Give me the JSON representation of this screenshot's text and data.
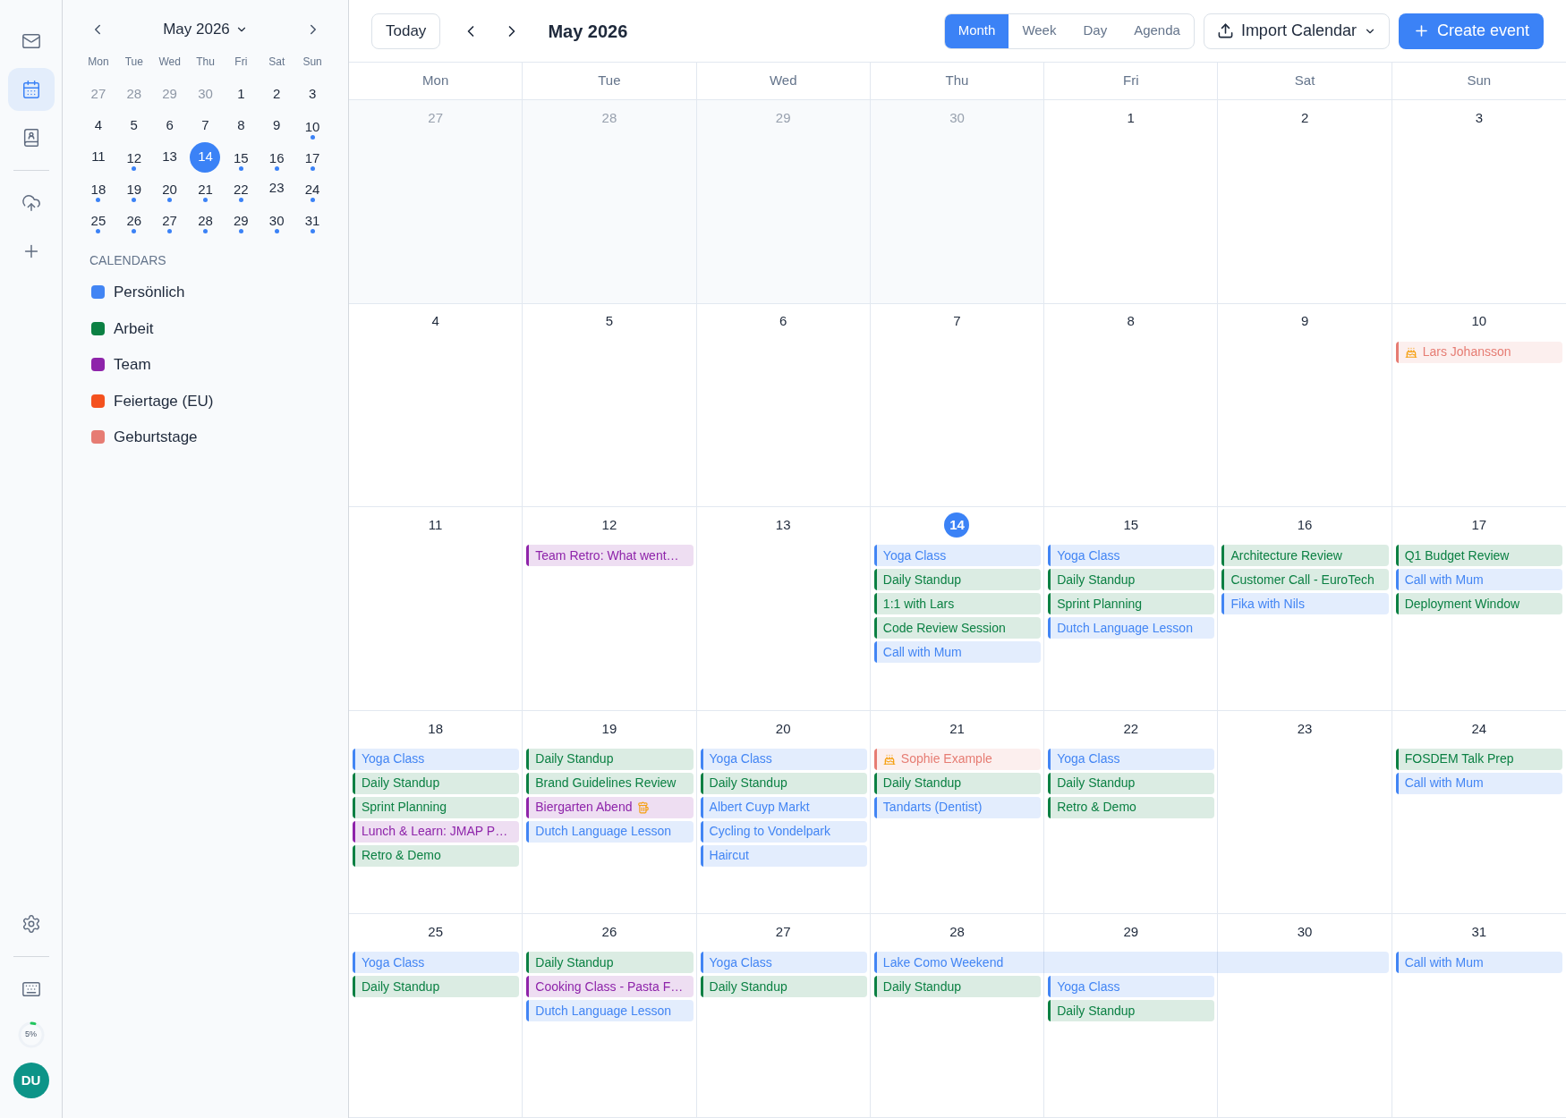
{
  "rail": {
    "top": [
      {
        "kind": "mail",
        "selected": false
      },
      {
        "kind": "calendar",
        "selected": true
      },
      {
        "kind": "contacts",
        "selected": false
      }
    ],
    "middle": [
      {
        "kind": "upload"
      },
      {
        "kind": "add"
      }
    ],
    "bottom": [
      {
        "kind": "settings"
      },
      {
        "kind": "keyboard"
      }
    ],
    "storage": {
      "level": 0.05,
      "label": "5%"
    },
    "avatar": "DU"
  },
  "mini_calendar": {
    "title": "May 2026",
    "weekdays": [
      "Mon",
      "Tue",
      "Wed",
      "Thu",
      "Fri",
      "Sat",
      "Sun"
    ],
    "days": [
      {
        "label": "27",
        "muted": true,
        "selected": false,
        "has_events": false
      },
      {
        "label": "28",
        "muted": true,
        "selected": false,
        "has_events": false
      },
      {
        "label": "29",
        "muted": true,
        "selected": false,
        "has_events": false
      },
      {
        "label": "30",
        "muted": true,
        "selected": false,
        "has_events": false
      },
      {
        "label": "1",
        "muted": false,
        "selected": false,
        "has_events": false
      },
      {
        "label": "2",
        "muted": false,
        "selected": false,
        "has_events": false
      },
      {
        "label": "3",
        "muted": false,
        "selected": false,
        "has_events": false
      },
      {
        "label": "4",
        "muted": false,
        "selected": false,
        "has_events": false
      },
      {
        "label": "5",
        "muted": false,
        "selected": false,
        "has_events": false
      },
      {
        "label": "6",
        "muted": false,
        "selected": false,
        "has_events": false
      },
      {
        "label": "7",
        "muted": false,
        "selected": false,
        "has_events": false
      },
      {
        "label": "8",
        "muted": false,
        "selected": false,
        "has_events": false
      },
      {
        "label": "9",
        "muted": false,
        "selected": false,
        "has_events": false
      },
      {
        "label": "10",
        "muted": false,
        "selected": false,
        "has_events": true
      },
      {
        "label": "11",
        "muted": false,
        "selected": false,
        "has_events": false
      },
      {
        "label": "12",
        "muted": false,
        "selected": false,
        "has_events": true
      },
      {
        "label": "13",
        "muted": false,
        "selected": false,
        "has_events": false
      },
      {
        "label": "14",
        "muted": false,
        "selected": true,
        "has_events": false
      },
      {
        "label": "15",
        "muted": false,
        "selected": false,
        "has_events": true
      },
      {
        "label": "16",
        "muted": false,
        "selected": false,
        "has_events": true
      },
      {
        "label": "17",
        "muted": false,
        "selected": false,
        "has_events": true
      },
      {
        "label": "18",
        "muted": false,
        "selected": false,
        "has_events": true
      },
      {
        "label": "19",
        "muted": false,
        "selected": false,
        "has_events": true
      },
      {
        "label": "20",
        "muted": false,
        "selected": false,
        "has_events": true
      },
      {
        "label": "21",
        "muted": false,
        "selected": false,
        "has_events": true
      },
      {
        "label": "22",
        "muted": false,
        "selected": false,
        "has_events": true
      },
      {
        "label": "23",
        "muted": false,
        "selected": false,
        "has_events": false
      },
      {
        "label": "24",
        "muted": false,
        "selected": false,
        "has_events": true
      },
      {
        "label": "25",
        "muted": false,
        "selected": false,
        "has_events": true
      },
      {
        "label": "26",
        "muted": false,
        "selected": false,
        "has_events": true
      },
      {
        "label": "27",
        "muted": false,
        "selected": false,
        "has_events": true
      },
      {
        "label": "28",
        "muted": false,
        "selected": false,
        "has_events": true
      },
      {
        "label": "29",
        "muted": false,
        "selected": false,
        "has_events": true
      },
      {
        "label": "30",
        "muted": false,
        "selected": false,
        "has_events": true
      },
      {
        "label": "31",
        "muted": false,
        "selected": false,
        "has_events": true
      }
    ]
  },
  "calendars": {
    "heading": "CALENDARS",
    "items": [
      {
        "name": "Persönlich",
        "color": "#4285f4"
      },
      {
        "name": "Arbeit",
        "color": "#0b8043"
      },
      {
        "name": "Team",
        "color": "#8e24aa"
      },
      {
        "name": "Feiertage (EU)",
        "color": "#f4511e"
      },
      {
        "name": "Geburtstage",
        "color": "#e67c73"
      }
    ]
  },
  "toolbar": {
    "today": "Today",
    "title": "May 2026",
    "views": [
      {
        "label": "Month",
        "selected": true
      },
      {
        "label": "Week",
        "selected": false
      },
      {
        "label": "Day",
        "selected": false
      },
      {
        "label": "Agenda",
        "selected": false
      }
    ],
    "import": "Import Calendar",
    "create": "Create event"
  },
  "month": {
    "weekdays": [
      "Mon",
      "Tue",
      "Wed",
      "Thu",
      "Fri",
      "Sat",
      "Sun"
    ],
    "weeks": [
      {
        "days": [
          {
            "date": "27",
            "muted": true,
            "today": false
          },
          {
            "date": "28",
            "muted": true,
            "today": false
          },
          {
            "date": "29",
            "muted": true,
            "today": false
          },
          {
            "date": "30",
            "muted": true,
            "today": false
          },
          {
            "date": "1",
            "muted": false,
            "today": false
          },
          {
            "date": "2",
            "muted": false,
            "today": false
          },
          {
            "date": "3",
            "muted": false,
            "today": false
          }
        ]
      },
      {
        "days": [
          {
            "date": "4",
            "muted": false,
            "today": false
          },
          {
            "date": "5",
            "muted": false,
            "today": false
          },
          {
            "date": "6",
            "muted": false,
            "today": false
          },
          {
            "date": "7",
            "muted": false,
            "today": false
          },
          {
            "date": "8",
            "muted": false,
            "today": false
          },
          {
            "date": "9",
            "muted": false,
            "today": false
          },
          {
            "date": "10",
            "muted": false,
            "today": false,
            "events": [
              {
                "kind": "birthday",
                "title": "Lars Johansson",
                "color": "#e67c73"
              }
            ]
          }
        ]
      },
      {
        "days": [
          {
            "date": "11",
            "muted": false,
            "today": false
          },
          {
            "date": "12",
            "muted": false,
            "today": false,
            "events": [
              {
                "kind": "event",
                "title": "Team Retro: What went…",
                "color": "#8e24aa"
              }
            ]
          },
          {
            "date": "13",
            "muted": false,
            "today": false
          },
          {
            "date": "14",
            "muted": false,
            "today": true,
            "events": [
              {
                "kind": "event",
                "title": "Yoga Class",
                "color": "#4285f4"
              },
              {
                "kind": "event",
                "title": "Daily Standup",
                "color": "#0b8043"
              },
              {
                "kind": "event",
                "title": "1:1 with Lars",
                "color": "#0b8043"
              },
              {
                "kind": "event",
                "title": "Code Review Session",
                "color": "#0b8043"
              },
              {
                "kind": "event",
                "title": "Call with Mum",
                "color": "#4285f4"
              }
            ]
          },
          {
            "date": "15",
            "muted": false,
            "today": false,
            "events": [
              {
                "kind": "event",
                "title": "Yoga Class",
                "color": "#4285f4"
              },
              {
                "kind": "event",
                "title": "Daily Standup",
                "color": "#0b8043"
              },
              {
                "kind": "event",
                "title": "Sprint Planning",
                "color": "#0b8043"
              },
              {
                "kind": "event",
                "title": "Dutch Language Lesson",
                "color": "#4285f4"
              }
            ]
          },
          {
            "date": "16",
            "muted": false,
            "today": false,
            "events": [
              {
                "kind": "event",
                "title": "Architecture Review",
                "color": "#0b8043"
              },
              {
                "kind": "event",
                "title": "Customer Call - EuroTech",
                "color": "#0b8043"
              },
              {
                "kind": "event",
                "title": "Fika with Nils",
                "color": "#4285f4"
              }
            ]
          },
          {
            "date": "17",
            "muted": false,
            "today": false,
            "events": [
              {
                "kind": "event",
                "title": "Q1 Budget Review",
                "color": "#0b8043"
              },
              {
                "kind": "event",
                "title": "Call with Mum",
                "color": "#4285f4"
              },
              {
                "kind": "event",
                "title": "Deployment Window",
                "color": "#0b8043"
              }
            ]
          }
        ]
      },
      {
        "days": [
          {
            "date": "18",
            "muted": false,
            "today": false,
            "events": [
              {
                "kind": "event",
                "title": "Yoga Class",
                "color": "#4285f4"
              },
              {
                "kind": "event",
                "title": "Daily Standup",
                "color": "#0b8043"
              },
              {
                "kind": "event",
                "title": "Sprint Planning",
                "color": "#0b8043"
              },
              {
                "kind": "event",
                "title": "Lunch & Learn: JMAP P…",
                "color": "#8e24aa"
              },
              {
                "kind": "event",
                "title": "Retro & Demo",
                "color": "#0b8043"
              }
            ]
          },
          {
            "date": "19",
            "muted": false,
            "today": false,
            "events": [
              {
                "kind": "event",
                "title": "Daily Standup",
                "color": "#0b8043"
              },
              {
                "kind": "event",
                "title": "Brand Guidelines Review",
                "color": "#0b8043"
              },
              {
                "kind": "drinks",
                "title": "Biergarten Abend",
                "color": "#8e24aa"
              },
              {
                "kind": "event",
                "title": "Dutch Language Lesson",
                "color": "#4285f4"
              }
            ]
          },
          {
            "date": "20",
            "muted": false,
            "today": false,
            "events": [
              {
                "kind": "event",
                "title": "Yoga Class",
                "color": "#4285f4"
              },
              {
                "kind": "event",
                "title": "Daily Standup",
                "color": "#0b8043"
              },
              {
                "kind": "event",
                "title": "Albert Cuyp Markt",
                "color": "#4285f4"
              },
              {
                "kind": "event",
                "title": "Cycling to Vondelpark",
                "color": "#4285f4"
              },
              {
                "kind": "event",
                "title": "Haircut",
                "color": "#4285f4"
              }
            ]
          },
          {
            "date": "21",
            "muted": false,
            "today": false,
            "events": [
              {
                "kind": "birthday",
                "title": "Sophie Example",
                "color": "#e67c73"
              },
              {
                "kind": "event",
                "title": "Daily Standup",
                "color": "#0b8043"
              },
              {
                "kind": "event",
                "title": "Tandarts (Dentist)",
                "color": "#4285f4"
              }
            ]
          },
          {
            "date": "22",
            "muted": false,
            "today": false,
            "events": [
              {
                "kind": "event",
                "title": "Yoga Class",
                "color": "#4285f4"
              },
              {
                "kind": "event",
                "title": "Daily Standup",
                "color": "#0b8043"
              },
              {
                "kind": "event",
                "title": "Retro & Demo",
                "color": "#0b8043"
              }
            ]
          },
          {
            "date": "23",
            "muted": false,
            "today": false
          },
          {
            "date": "24",
            "muted": false,
            "today": false,
            "events": [
              {
                "kind": "event",
                "title": "FOSDEM Talk Prep",
                "color": "#0b8043"
              },
              {
                "kind": "event",
                "title": "Call with Mum",
                "color": "#4285f4"
              }
            ]
          }
        ]
      },
      {
        "days": [
          {
            "date": "25",
            "muted": false,
            "today": false,
            "events": [
              {
                "kind": "event",
                "title": "Yoga Class",
                "color": "#4285f4"
              },
              {
                "kind": "event",
                "title": "Daily Standup",
                "color": "#0b8043"
              }
            ]
          },
          {
            "date": "26",
            "muted": false,
            "today": false,
            "events": [
              {
                "kind": "event",
                "title": "Daily Standup",
                "color": "#0b8043"
              },
              {
                "kind": "event",
                "title": "Cooking Class - Pasta F…",
                "color": "#8e24aa"
              },
              {
                "kind": "event",
                "title": "Dutch Language Lesson",
                "color": "#4285f4"
              }
            ]
          },
          {
            "date": "27",
            "muted": false,
            "today": false,
            "events": [
              {
                "kind": "event",
                "title": "Yoga Class",
                "color": "#4285f4"
              },
              {
                "kind": "event",
                "title": "Daily Standup",
                "color": "#0b8043"
              }
            ]
          },
          {
            "date": "28",
            "muted": false,
            "today": false,
            "events": [
              {
                "kind": "multi_day",
                "title": "Lake Como Weekend",
                "color": "#4285f4"
              },
              {
                "kind": "event",
                "title": "Daily Standup",
                "color": "#0b8043"
              }
            ]
          },
          {
            "date": "29",
            "muted": false,
            "today": false,
            "events": [
              {
                "kind": "continuation"
              },
              {
                "kind": "event",
                "title": "Yoga Class",
                "color": "#4285f4"
              },
              {
                "kind": "event",
                "title": "Daily Standup",
                "color": "#0b8043"
              }
            ]
          },
          {
            "date": "30",
            "muted": false,
            "today": false,
            "events": [
              {
                "kind": "continuation"
              }
            ]
          },
          {
            "date": "31",
            "muted": false,
            "today": false,
            "events": [
              {
                "kind": "event",
                "title": "Call with Mum",
                "color": "#4285f4"
              }
            ]
          }
        ]
      }
    ]
  }
}
